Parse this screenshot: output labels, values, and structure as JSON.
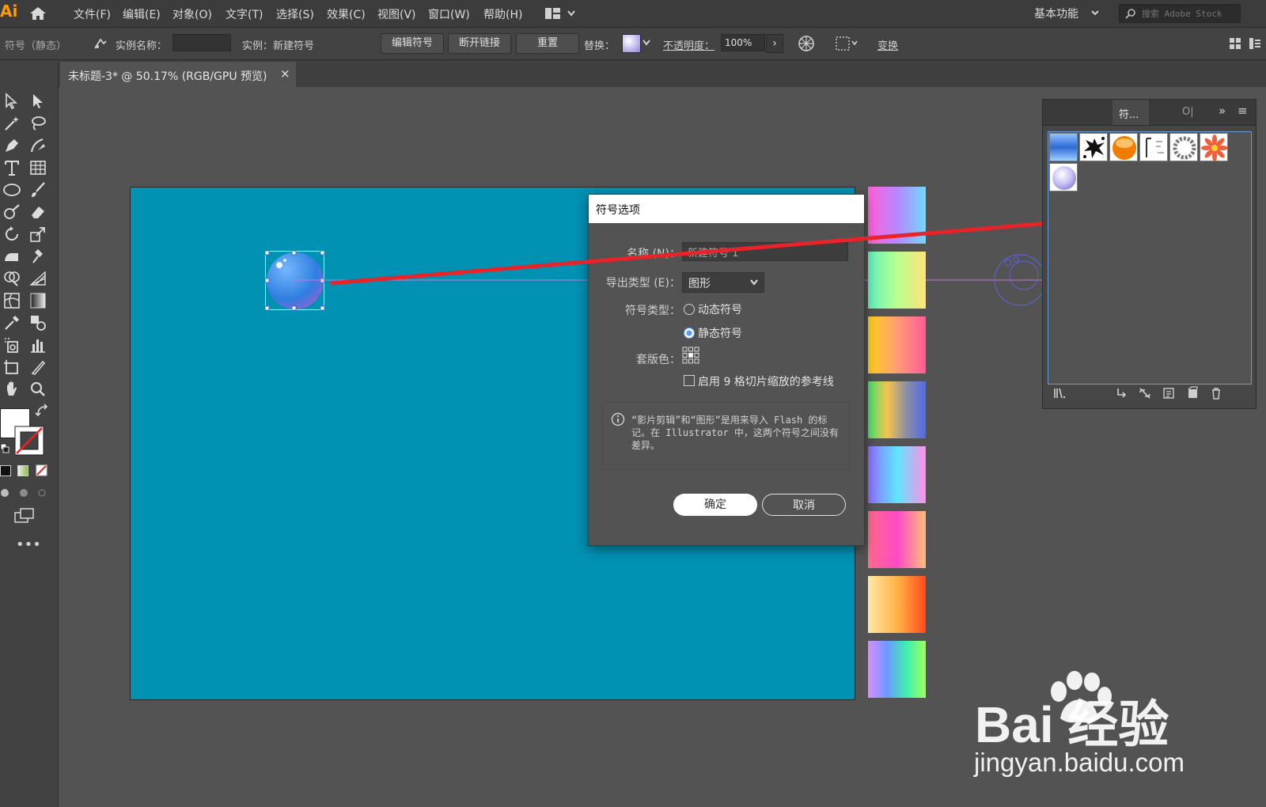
{
  "app": {
    "logo": "Ai"
  },
  "menu": {
    "items": [
      "文件(F)",
      "编辑(E)",
      "对象(O)",
      "文字(T)",
      "选择(S)",
      "效果(C)",
      "视图(V)",
      "窗口(W)",
      "帮助(H)"
    ],
    "workspace": "基本功能",
    "search_placeholder": "搜索 Adobe Stock"
  },
  "control": {
    "mode": "符号（静态）",
    "instance_name_label": "实例名称：",
    "instance_name_value": "",
    "instance_label": "实例：新建符号",
    "edit_symbol": "编辑符号",
    "break_link": "断开链接",
    "reset": "重置",
    "replace_label": "替换：",
    "opacity_label": "不透明度：",
    "opacity_value": "100%",
    "transform": "变换"
  },
  "document": {
    "tab_title": "未标题-3* @ 50.17% (RGB/GPU 预览)",
    "artboard_color": "#0091b3"
  },
  "dialog": {
    "title": "符号选项",
    "name_label": "名称 (N)：",
    "name_value": "新建符号 1",
    "export_label": "导出类型 (E)：",
    "export_value": "图形",
    "type_label": "符号类型：",
    "type_dynamic": "动态符号",
    "type_static": "静态符号",
    "selected_type": "static",
    "registration_label": "套版色：",
    "nine_slice_label": "启用 9 格切片缩放的参考线",
    "nine_slice_checked": false,
    "info": "“影片剪辑”和“图形”是用来导入 Flash 的标记。在 Illustrator 中，这两个符号之间没有差异。",
    "ok": "确定",
    "cancel": "取消"
  },
  "symbols_panel": {
    "tab": "符...",
    "other_tab": "O|",
    "expand": "»",
    "menu": "≡",
    "foot_icons": [
      "symbol-libraries-icon",
      "place-symbol-icon",
      "break-link-icon",
      "symbol-options-icon",
      "new-symbol-icon",
      "delete-icon"
    ]
  },
  "watermark": {
    "brand": "Bai 经验",
    "url": "jingyan.baidu.com"
  },
  "colors": {
    "accent": "#6a9bd8",
    "arrow": "#e8242a",
    "logo": "#ff9a00"
  }
}
